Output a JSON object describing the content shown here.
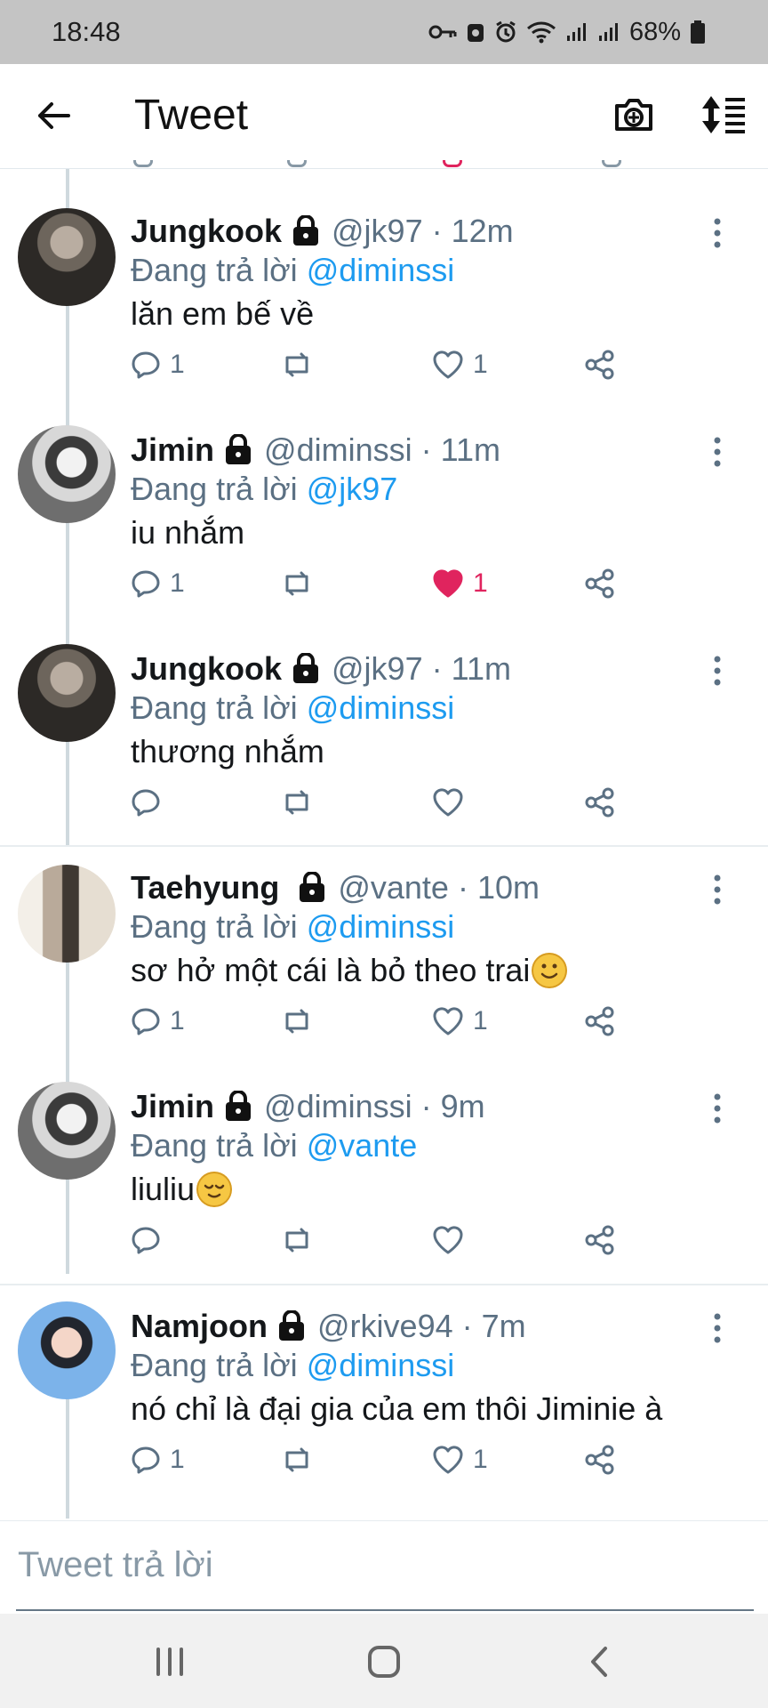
{
  "status": {
    "time": "18:48",
    "battery": "68%",
    "icons": [
      "key-icon",
      "recycle-icon",
      "alarm-icon",
      "wifi-icon",
      "signal-icon",
      "signal-icon",
      "battery-icon"
    ]
  },
  "header": {
    "title": "Tweet"
  },
  "reply_prefix": "Đang trả lời",
  "tweets": [
    {
      "name": "Jungkook",
      "handle": "@jk97 · 12m",
      "reply_to": "@diminssi",
      "text": "lăn em bế về",
      "reply_count": "1",
      "like_count": "1",
      "liked": false
    },
    {
      "name": "Jimin",
      "handle": "@diminssi · 11m",
      "reply_to": "@jk97",
      "text": "iu nhắm",
      "reply_count": "1",
      "like_count": "1",
      "liked": true
    },
    {
      "name": "Jungkook",
      "handle": "@jk97 · 11m",
      "reply_to": "@diminssi",
      "text": "thương nhắm",
      "reply_count": "",
      "like_count": "",
      "liked": false
    },
    {
      "name": "Taehyung",
      "handle": "@vante · 10m",
      "reply_to": "@diminssi",
      "text": "sơ hở một cái là bỏ theo trai",
      "reply_count": "1",
      "like_count": "1",
      "liked": false
    },
    {
      "name": "Jimin",
      "handle": "@diminssi · 9m",
      "reply_to": "@vante",
      "text": "liuliu",
      "reply_count": "",
      "like_count": "",
      "liked": false
    },
    {
      "name": "Namjoon",
      "handle": "@rkive94 · 7m",
      "reply_to": "@diminssi",
      "text": "nó chỉ là đại gia của em thôi Jiminie à",
      "reply_count": "1",
      "like_count": "1",
      "liked": false
    }
  ],
  "reply_box": {
    "placeholder": "Tweet trả lời"
  },
  "colors": {
    "link": "#1d9bf0",
    "like": "#e0245e",
    "muted": "#5b7083"
  }
}
